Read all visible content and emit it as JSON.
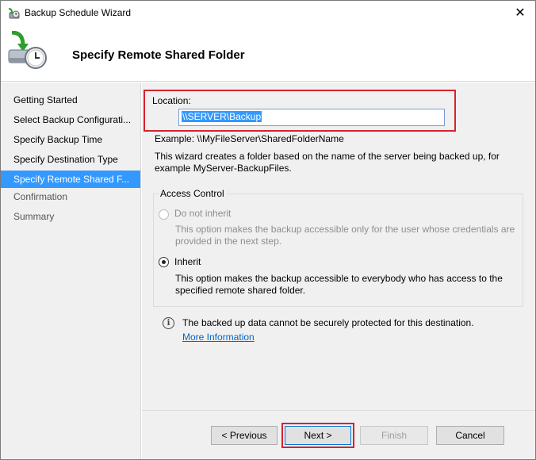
{
  "window": {
    "title": "Backup Schedule Wizard",
    "close_glyph": "✕"
  },
  "header": {
    "page_title": "Specify Remote Shared Folder"
  },
  "nav": {
    "items": [
      {
        "label": "Getting Started",
        "state": "normal"
      },
      {
        "label": "Select Backup Configurati...",
        "state": "normal"
      },
      {
        "label": "Specify Backup Time",
        "state": "normal"
      },
      {
        "label": "Specify Destination Type",
        "state": "normal"
      },
      {
        "label": "Specify Remote Shared F...",
        "state": "active"
      },
      {
        "label": "Confirmation",
        "state": "disabled"
      },
      {
        "label": "Summary",
        "state": "disabled"
      }
    ]
  },
  "main": {
    "location_label": "Location:",
    "location_value": "\\\\SERVER\\Backup",
    "example": "Example: \\\\MyFileServer\\SharedFolderName",
    "description": "This wizard creates a folder based on the name of the server being backed up, for example MyServer-BackupFiles.",
    "access_control": {
      "legend": "Access Control",
      "options": [
        {
          "label": "Do not inherit",
          "description": "This option makes the backup accessible only for the user whose credentials are provided in the next step.",
          "checked": false,
          "enabled": false
        },
        {
          "label": "Inherit",
          "description": "This option makes the backup accessible to everybody who has access to the specified remote shared folder.",
          "checked": true,
          "enabled": true
        }
      ]
    },
    "info_text": "The backed up data cannot be securely protected for this destination.",
    "more_info_link": "More Information"
  },
  "buttons": {
    "previous": "< Previous",
    "next": "Next >",
    "finish": "Finish",
    "cancel": "Cancel"
  },
  "colors": {
    "highlight": "#d6232e",
    "nav_active": "#3399ff",
    "link": "#0066cc"
  },
  "icons": {
    "title": "backup-wizard-icon",
    "header": "server-backup-clock-icon",
    "info": "info-icon",
    "close": "close-icon"
  }
}
